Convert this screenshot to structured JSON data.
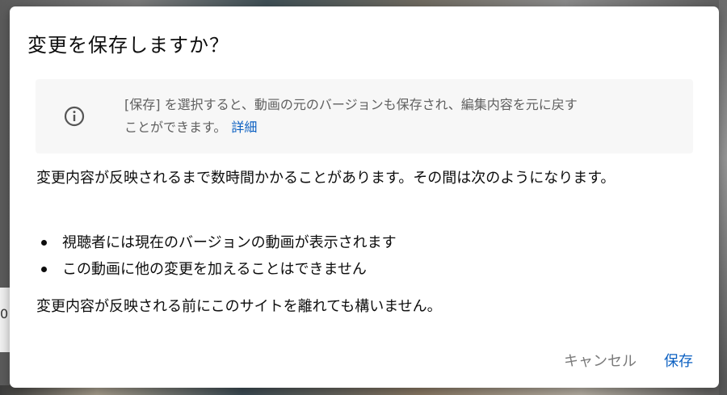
{
  "background": {
    "left_edge_text": "0"
  },
  "dialog": {
    "title": "変更を保存しますか？",
    "info": {
      "icon": "info-circle-icon",
      "text_line1": "[保存] を選択すると、動画の元のバージョンも保存され、編集内容を元に戻す",
      "text_line2": "ことができます。",
      "link": "詳細"
    },
    "paragraph1": "変更内容が反映されるまで数時間かかることがあります。その間は次のようになります。",
    "bullets": [
      "視聴者には現在のバージョンの動画が表示されます",
      "この動画に他の変更を加えることはできません"
    ],
    "paragraph2": "変更内容が反映される前にこのサイトを離れても構いません。",
    "buttons": {
      "cancel": "キャンセル",
      "save": "保存"
    }
  },
  "colors": {
    "accent": "#0d61c2",
    "info_bg": "#f7f7f7",
    "secondary_text": "#606060"
  }
}
